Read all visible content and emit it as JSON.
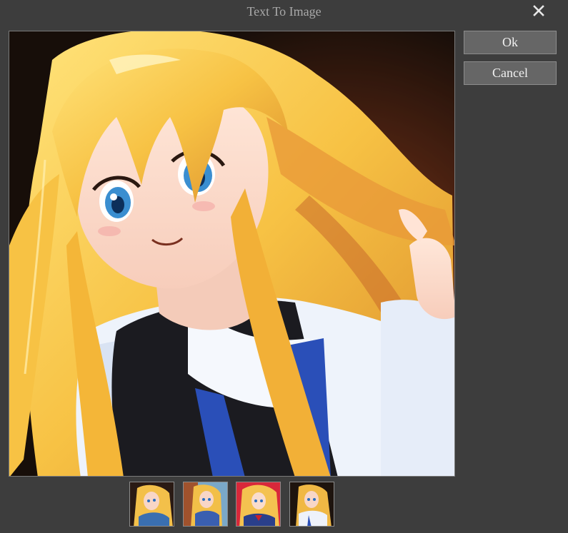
{
  "dialog": {
    "title": "Text To Image",
    "close_icon": "close-icon"
  },
  "buttons": {
    "ok_label": "Ok",
    "cancel_label": "Cancel"
  },
  "preview": {
    "description_icon": "generated-image-preview",
    "selected_index": 1
  },
  "thumbnails": [
    {
      "name": "thumbnail-1",
      "background": "#2a1a14",
      "accent": "#3a6fb0"
    },
    {
      "name": "thumbnail-2",
      "background": "#7aa8c8",
      "accent": "#3a5fb0"
    },
    {
      "name": "thumbnail-3",
      "background": "#d8283a",
      "accent": "#2a3f8a"
    },
    {
      "name": "thumbnail-4",
      "background": "#1e140e",
      "accent": "#eef2fa"
    }
  ],
  "colors": {
    "dialog_bg": "#3d3d3d",
    "button_bg": "#666666",
    "title_text": "#a9a9a9"
  }
}
